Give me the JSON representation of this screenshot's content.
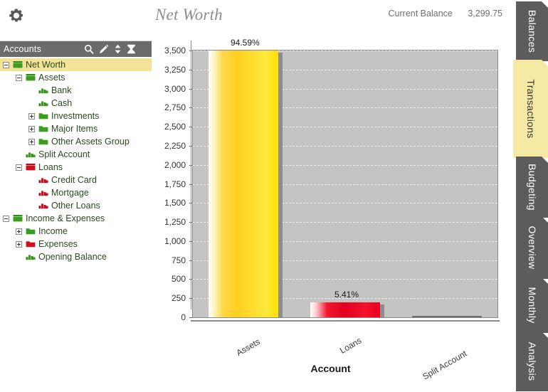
{
  "header": {
    "gear_icon": "gear-icon",
    "title": "Net Worth",
    "balance_label": "Current Balance",
    "balance_value": "3,299.75"
  },
  "accounts_panel": {
    "title": "Accounts",
    "tools": [
      {
        "name": "search-icon",
        "glyph": "search"
      },
      {
        "name": "edit-pencil-icon",
        "glyph": "pencil"
      },
      {
        "name": "sort-updown-icon",
        "glyph": "updown"
      },
      {
        "name": "filter-hourglass-icon",
        "glyph": "hourglass"
      }
    ],
    "tree": [
      {
        "label": "Net Worth",
        "depth": 0,
        "toggle": "minus",
        "icon": "folder-open-green",
        "selected": true
      },
      {
        "label": "Assets",
        "depth": 1,
        "toggle": "minus",
        "icon": "folder-open-green",
        "selected": false
      },
      {
        "label": "Bank",
        "depth": 2,
        "toggle": "none",
        "icon": "account-green",
        "selected": false
      },
      {
        "label": "Cash",
        "depth": 2,
        "toggle": "none",
        "icon": "account-green",
        "selected": false
      },
      {
        "label": "Investments",
        "depth": 2,
        "toggle": "plus",
        "icon": "folder-green",
        "selected": false
      },
      {
        "label": "Major Items",
        "depth": 2,
        "toggle": "plus",
        "icon": "folder-green",
        "selected": false
      },
      {
        "label": "Other Assets Group",
        "depth": 2,
        "toggle": "plus",
        "icon": "folder-green",
        "selected": false
      },
      {
        "label": "Split Account",
        "depth": 1,
        "toggle": "none",
        "icon": "account-green",
        "selected": false
      },
      {
        "label": "Loans",
        "depth": 1,
        "toggle": "minus",
        "icon": "folder-open-red",
        "selected": false
      },
      {
        "label": "Credit Card",
        "depth": 2,
        "toggle": "none",
        "icon": "account-red",
        "selected": false
      },
      {
        "label": "Mortgage",
        "depth": 2,
        "toggle": "none",
        "icon": "account-red",
        "selected": false
      },
      {
        "label": "Other Loans",
        "depth": 2,
        "toggle": "none",
        "icon": "account-red",
        "selected": false
      },
      {
        "label": "Income & Expenses",
        "depth": 0,
        "toggle": "minus",
        "icon": "folder-open-green",
        "selected": false
      },
      {
        "label": "Income",
        "depth": 1,
        "toggle": "plus",
        "icon": "folder-green",
        "selected": false
      },
      {
        "label": "Expenses",
        "depth": 1,
        "toggle": "plus",
        "icon": "folder-red",
        "selected": false
      },
      {
        "label": "Opening Balance",
        "depth": 1,
        "toggle": "none",
        "icon": "account-green",
        "selected": false
      }
    ]
  },
  "tabs": [
    {
      "label": "Balances",
      "active": false
    },
    {
      "label": "Transactions",
      "active": true
    },
    {
      "label": "Budgeting",
      "active": false
    },
    {
      "label": "Overview",
      "active": false
    },
    {
      "label": "Monthly",
      "active": false
    },
    {
      "label": "Analysis",
      "active": false
    }
  ],
  "chart_data": {
    "type": "bar",
    "title": "Net Worth",
    "xlabel": "Account",
    "ylabel": "",
    "categories": [
      "Assets",
      "Loans",
      "Split Account"
    ],
    "values": [
      3500,
      200,
      0
    ],
    "data_labels": [
      "94.59%",
      "5.41%",
      ""
    ],
    "ylim": [
      0,
      3500
    ],
    "ytick_labels": [
      "0",
      "250",
      "500",
      "750",
      "1,000",
      "1,250",
      "1,500",
      "1,750",
      "2,000",
      "2,250",
      "2,500",
      "2,750",
      "3,000",
      "3,250",
      "3,500"
    ],
    "ytick_values": [
      0,
      250,
      500,
      750,
      1000,
      1250,
      1500,
      1750,
      2000,
      2250,
      2500,
      2750,
      3000,
      3250,
      3500
    ],
    "grid": true,
    "legend": "none",
    "xtick_rotation": -30,
    "colors": {
      "assets": "#ffd000",
      "loans": "#e30022",
      "split_account": "#6f6f6f",
      "plot_background": "#c4c4c4",
      "gridline": "#efefef"
    }
  },
  "theme": {
    "header_bar": "#6b6b6b",
    "selected_row": "#f2e398",
    "tab_inactive": "#5c5c5c",
    "tab_active": "#f5e9a4",
    "tree_text": "#2b4a20"
  }
}
